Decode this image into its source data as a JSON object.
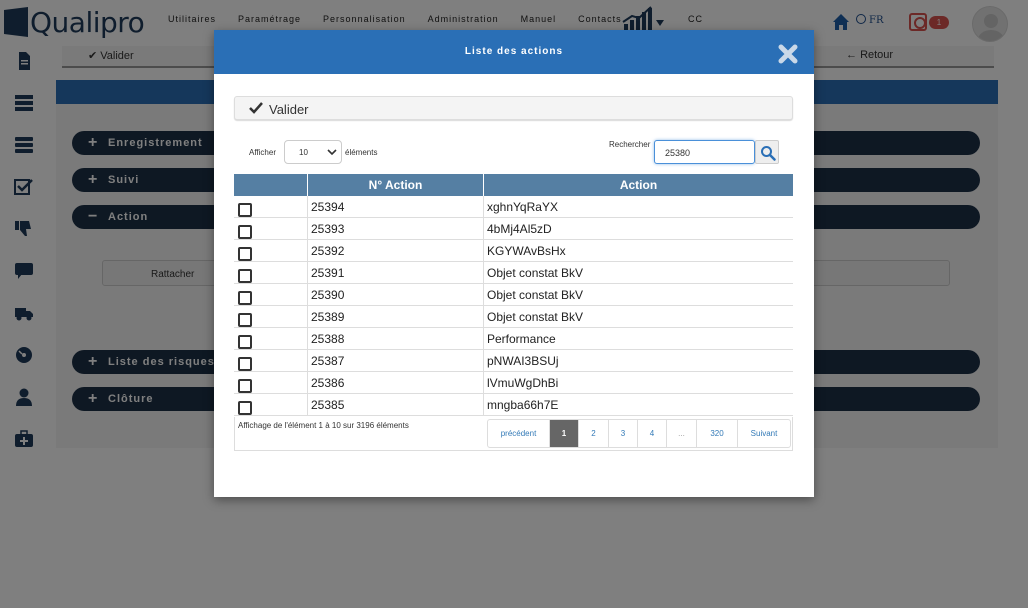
{
  "topbar": {
    "logo_text": "Qualipro",
    "menu": [
      "Utilitaires",
      "Paramétrage",
      "Personnalisation",
      "Administration",
      "Manuel",
      "Contacts"
    ],
    "cc": "CC",
    "lang": "FR",
    "notif_count": "1"
  },
  "sidebar": {
    "icons": [
      "file-icon",
      "server-icon",
      "database-icon",
      "checklist-icon",
      "thumbs-down-icon",
      "comment-icon",
      "truck-icon",
      "disc-icon",
      "user-icon",
      "medkit-icon"
    ]
  },
  "page": {
    "valider": "Valider",
    "retour": "Retour",
    "sections": [
      {
        "sign": "+",
        "label": "Enregistrement"
      },
      {
        "sign": "+",
        "label": "Suivi"
      },
      {
        "sign": "−",
        "label": "Action"
      },
      {
        "sign": "+",
        "label": "Liste des risques/o"
      },
      {
        "sign": "+",
        "label": "Clôture"
      }
    ],
    "rattacher": "Rattacher"
  },
  "modal": {
    "title": "Liste des actions",
    "valider": "Valider",
    "afficher": "Afficher",
    "length_value": "10",
    "elements": "éléments",
    "rechercher": "Rechercher",
    "search_value": "25380",
    "columns": [
      "",
      "N° Action",
      "Action"
    ],
    "rows": [
      {
        "num": "25394",
        "action": "xghnYqRaYX"
      },
      {
        "num": "25393",
        "action": "4bMj4Al5zD"
      },
      {
        "num": "25392",
        "action": "KGYWAvBsHx"
      },
      {
        "num": "25391",
        "action": "Objet constat BkV"
      },
      {
        "num": "25390",
        "action": "Objet constat BkV"
      },
      {
        "num": "25389",
        "action": "Objet constat BkV"
      },
      {
        "num": "25388",
        "action": "Performance"
      },
      {
        "num": "25387",
        "action": "pNWAI3BSUj"
      },
      {
        "num": "25386",
        "action": "lVmuWgDhBi"
      },
      {
        "num": "25385",
        "action": "mngba66h7E"
      }
    ],
    "info": "Affichage de l'élément 1 à 10 sur 3196 éléments",
    "pagination": [
      "précédent",
      "1",
      "2",
      "3",
      "4",
      "...",
      "320",
      "Suivant"
    ],
    "active_page": "1"
  },
  "colors": {
    "primary_blue": "#2a6fb6",
    "navy": "#1d3147",
    "table_header": "#557fa3",
    "badge_red": "#d9534f"
  }
}
